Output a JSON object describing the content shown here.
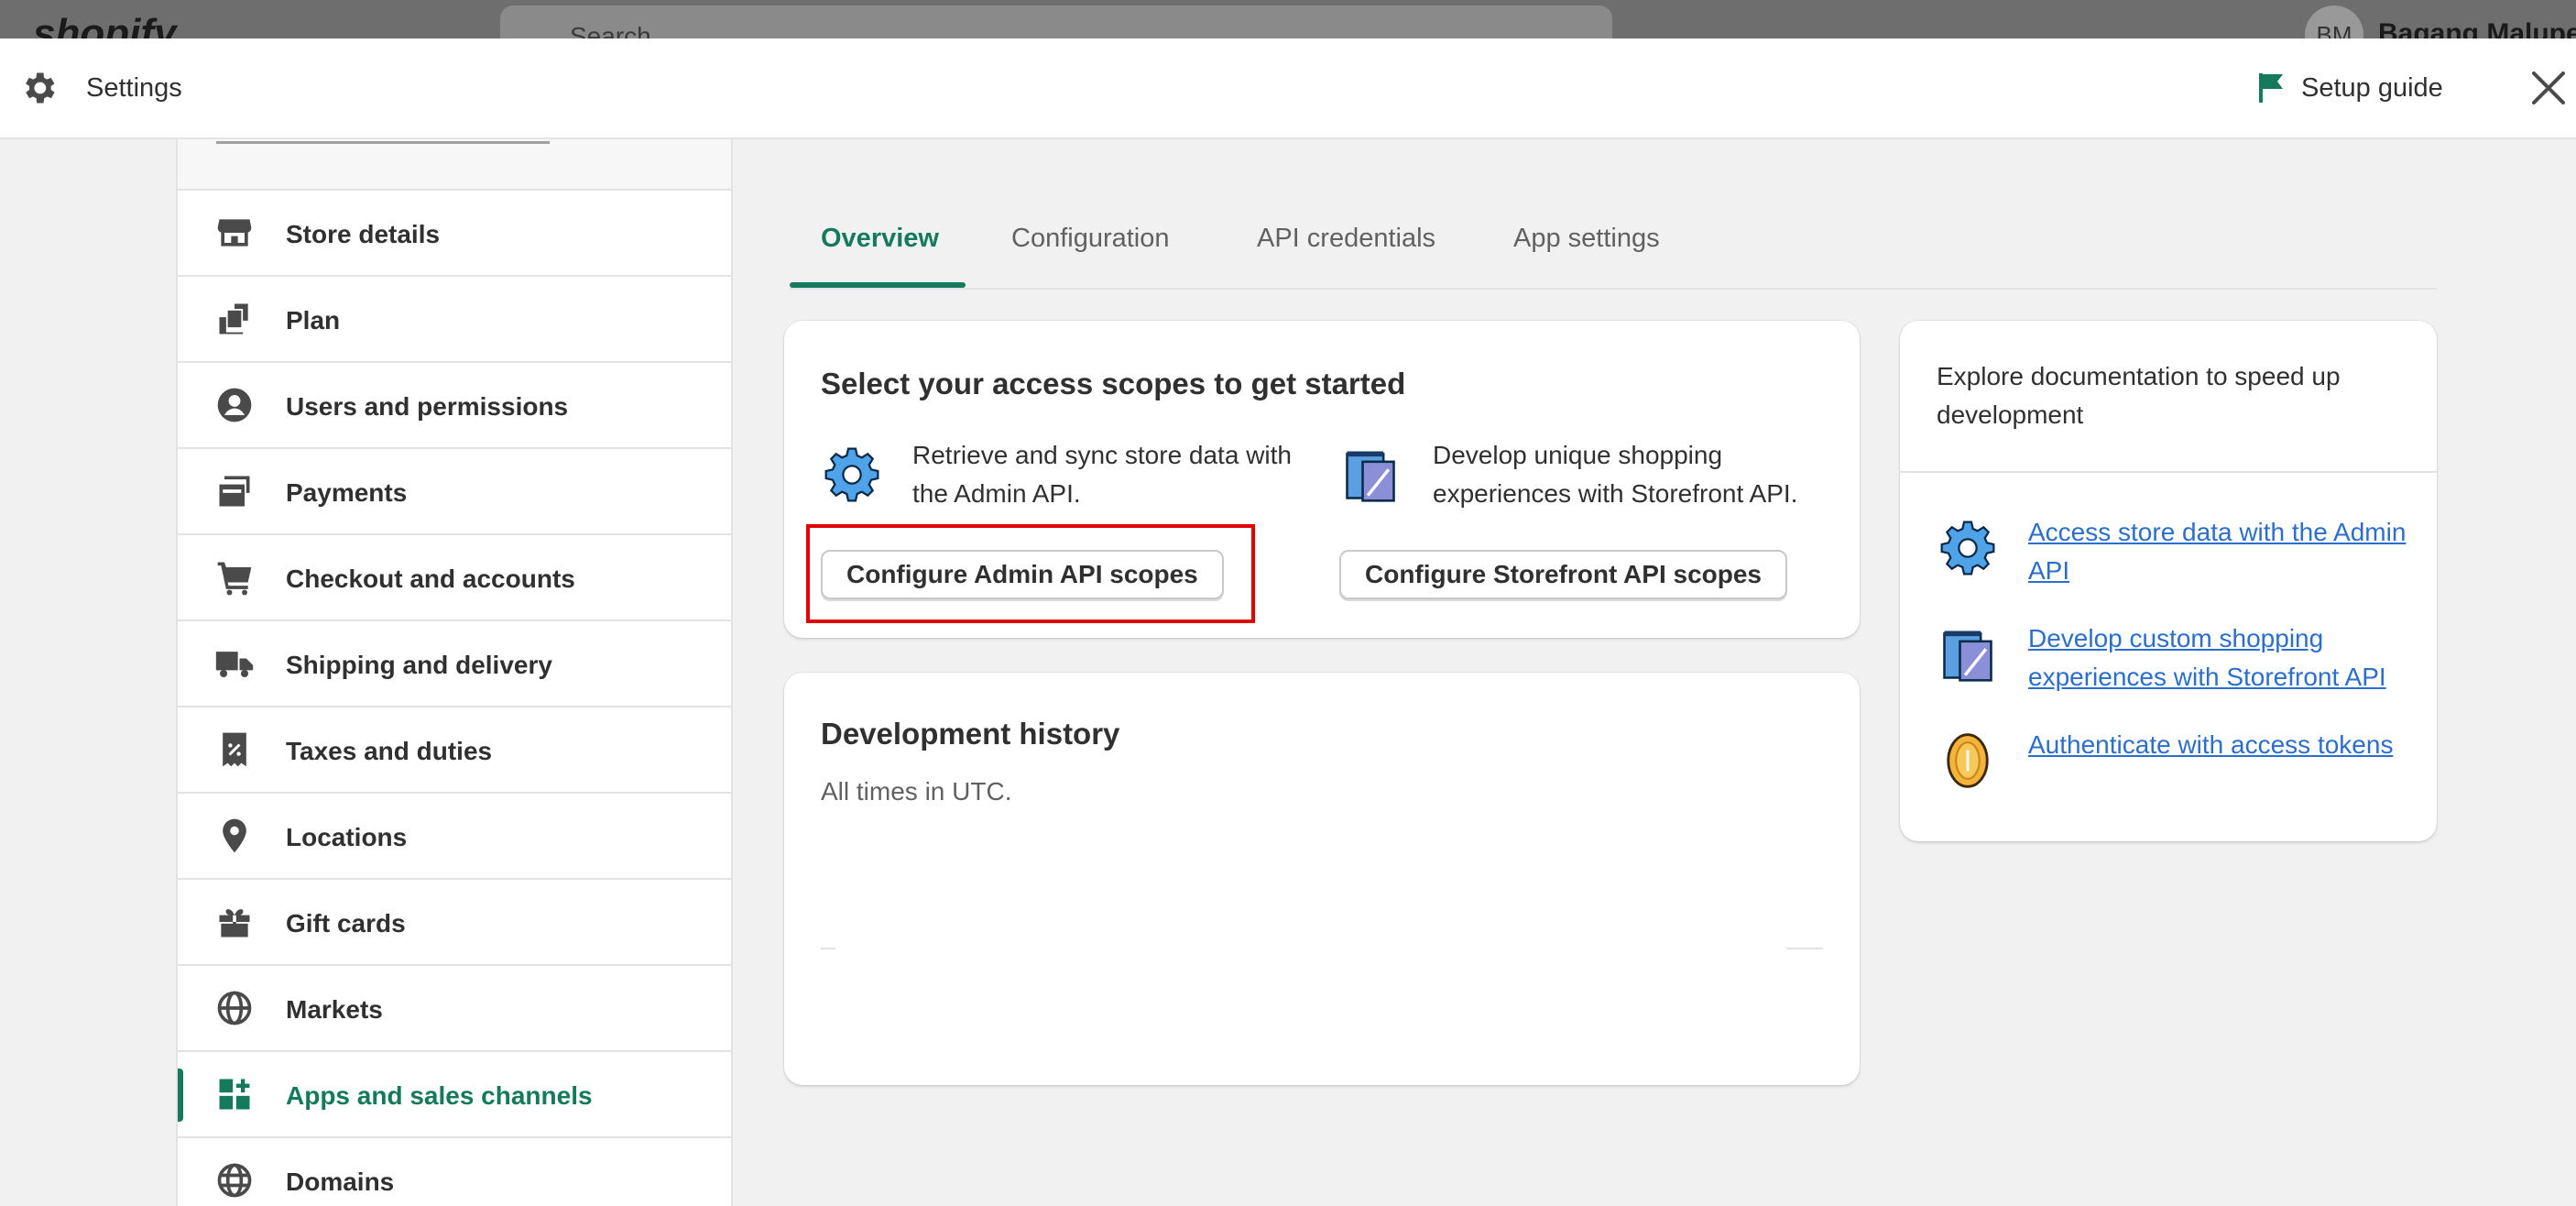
{
  "topbar": {
    "logo": "shopify",
    "search_placeholder": "Search",
    "avatar_initials": "BM",
    "user_name": "Bagang Malupet"
  },
  "header": {
    "title": "Settings",
    "setup_guide": "Setup guide"
  },
  "sidebar": {
    "items": [
      {
        "label": "Store details",
        "icon": "store-icon"
      },
      {
        "label": "Plan",
        "icon": "plan-icon"
      },
      {
        "label": "Users and permissions",
        "icon": "user-icon"
      },
      {
        "label": "Payments",
        "icon": "payments-icon"
      },
      {
        "label": "Checkout and accounts",
        "icon": "cart-icon"
      },
      {
        "label": "Shipping and delivery",
        "icon": "truck-icon"
      },
      {
        "label": "Taxes and duties",
        "icon": "receipt-icon"
      },
      {
        "label": "Locations",
        "icon": "location-pin-icon"
      },
      {
        "label": "Gift cards",
        "icon": "gift-icon"
      },
      {
        "label": "Markets",
        "icon": "globe-icon"
      },
      {
        "label": "Apps and sales channels",
        "icon": "apps-icon",
        "active": true
      },
      {
        "label": "Domains",
        "icon": "domain-globe-icon"
      }
    ]
  },
  "tabs": [
    {
      "label": "Overview",
      "active": true
    },
    {
      "label": "Configuration"
    },
    {
      "label": "API credentials"
    },
    {
      "label": "App settings"
    }
  ],
  "scopes_card": {
    "title": "Select your access scopes to get started",
    "admin_text": "Retrieve and sync store data with the Admin API.",
    "storefront_text": "Develop unique shopping experiences with Storefront API.",
    "admin_button": "Configure Admin API scopes",
    "storefront_button": "Configure Storefront API scopes"
  },
  "history_card": {
    "title": "Development history",
    "subtitle": "All times in UTC."
  },
  "docs_card": {
    "title": "Explore documentation to speed up development",
    "links": [
      {
        "label": "Access store data with the Admin API",
        "icon": "gear-badge-icon"
      },
      {
        "label": "Develop custom shopping experiences with Storefront API",
        "icon": "storefront-badge-icon"
      },
      {
        "label": "Authenticate with access tokens",
        "icon": "coin-badge-icon"
      }
    ]
  },
  "colors": {
    "accent": "#157a5c",
    "link": "#2c6ecb",
    "highlight": "#e00000"
  }
}
